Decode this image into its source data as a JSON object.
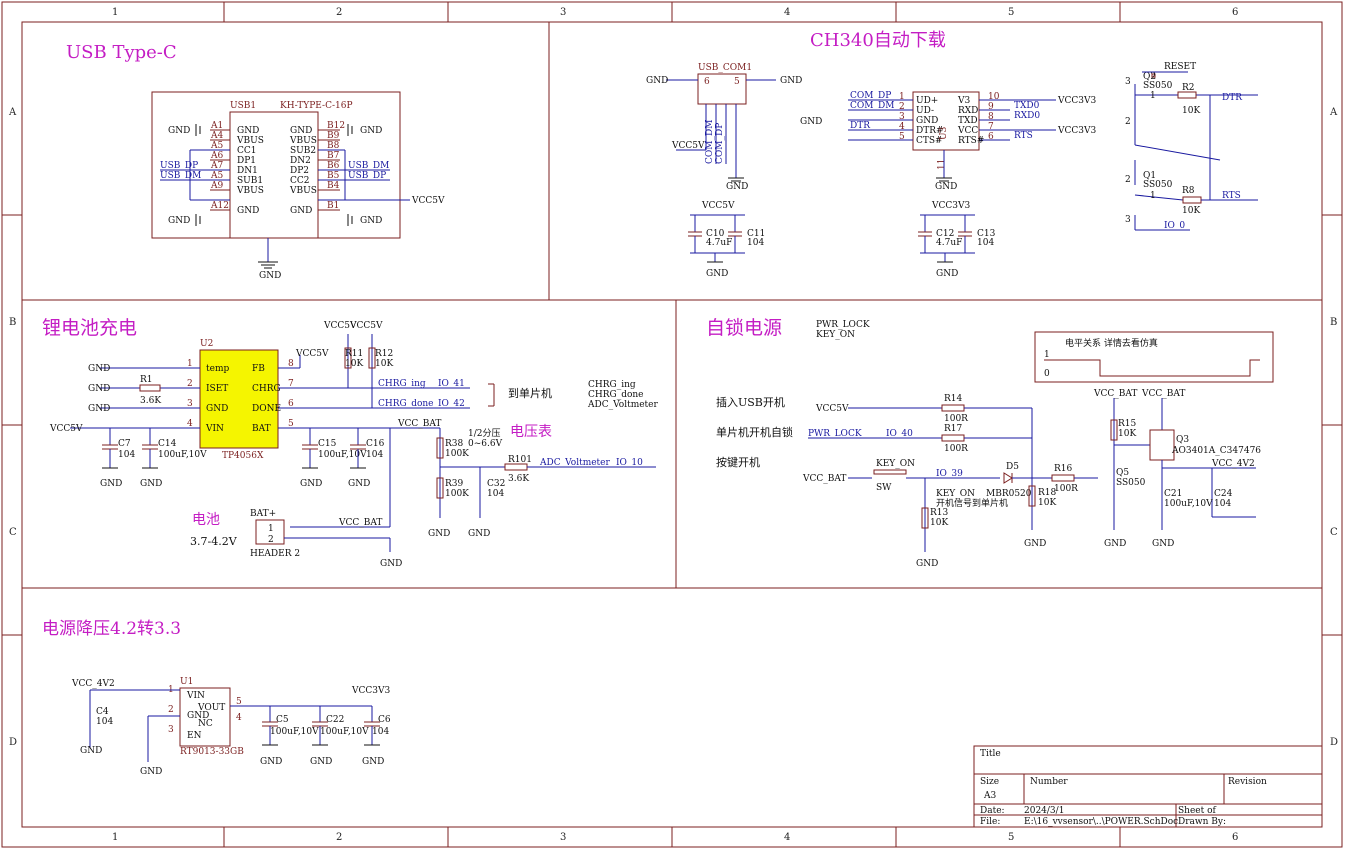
{
  "columns": [
    "1",
    "2",
    "3",
    "4",
    "5",
    "6"
  ],
  "rows": [
    "A",
    "B",
    "C",
    "D"
  ],
  "sections": {
    "usb": "USB Type-C",
    "ch340": "CH340自动下载",
    "battery": "锂电池充电",
    "selflock": "自锁电源",
    "ldo": "电源降压4.2转3.3"
  },
  "usb": {
    "designator": "USB1",
    "part": "KH-TYPE-C-16P",
    "left_pins": [
      [
        "A1",
        "GND"
      ],
      [
        "A4",
        "VBUS"
      ],
      [
        "A5",
        "CC1"
      ],
      [
        "A6",
        "DP1"
      ],
      [
        "A7",
        "DN1"
      ],
      [
        "A5",
        "SUB1"
      ],
      [
        "A9",
        "VBUS"
      ],
      [
        "A12",
        "GND"
      ]
    ],
    "right_pins": [
      [
        "B12",
        "GND"
      ],
      [
        "B9",
        "VBUS"
      ],
      [
        "B8",
        "SUB2"
      ],
      [
        "B7",
        "DN2"
      ],
      [
        "B6",
        "DP2"
      ],
      [
        "B5",
        "CC2"
      ],
      [
        "B4",
        "VBUS"
      ],
      [
        "B1",
        "GND"
      ]
    ],
    "nets": {
      "gnd": "GND",
      "dp": "USB_DP",
      "dm": "USB_DM",
      "vcc5v": "VCC5V"
    }
  },
  "usbcom": {
    "label": "USB_COM1",
    "pins": [
      "6",
      "5",
      "1",
      "2",
      "3",
      "4"
    ],
    "nets": [
      "COM_DM",
      "COM_DP",
      "VCC5V",
      "GND"
    ]
  },
  "ch340": {
    "left_pins": [
      [
        "1",
        "UD+"
      ],
      [
        "2",
        "UD-"
      ],
      [
        "3",
        "GND"
      ],
      [
        "4",
        "DTR#"
      ],
      [
        "5",
        "CTS#"
      ]
    ],
    "right_pins": [
      [
        "10",
        "V3"
      ],
      [
        "9",
        "RXD"
      ],
      [
        "8",
        "TXD"
      ],
      [
        "7",
        "VCC"
      ],
      [
        "6",
        "RTS#"
      ]
    ],
    "pad": "11",
    "refs": [
      "U3"
    ],
    "left_nets": [
      "COM_DP",
      "COM_DM",
      "GND",
      "DTR"
    ],
    "right_nets": [
      "VCC3V3",
      "TXD0",
      "RXD0",
      "VCC3V3",
      "RTS"
    ]
  },
  "caps_top": [
    {
      "net": "VCC5V",
      "c1": "C10",
      "v1": "4.7uF",
      "c2": "C11",
      "v2": "104"
    },
    {
      "net": "VCC3V3",
      "c1": "C12",
      "v1": "4.7uF",
      "c2": "C13",
      "v2": "104"
    }
  ],
  "autodl": {
    "q2": "Q2",
    "q1": "Q1",
    "model": "SS050",
    "model2": "SS050",
    "r2": "R2",
    "r8": "R8",
    "rv": "10K",
    "nets": [
      "RESET",
      "DTR",
      "RTS",
      "IO_0"
    ],
    "pin_nums": [
      "3",
      "1",
      "2"
    ]
  },
  "charger": {
    "designator": "U2",
    "part": "TP4056X",
    "left_pins": [
      [
        "1",
        "temp"
      ],
      [
        "2",
        "ISET"
      ],
      [
        "3",
        "GND"
      ],
      [
        "4",
        "VIN"
      ]
    ],
    "right_pins": [
      [
        "8",
        "FB"
      ],
      [
        "7",
        "CHRG"
      ],
      [
        "6",
        "DONE"
      ],
      [
        "5",
        "BAT"
      ]
    ],
    "nets": [
      "VCC5V",
      "VCC5V",
      "VCC5V",
      "VCC_BAT",
      "CHRG_ing",
      "CHRG_done",
      "IO_41",
      "IO_42",
      "GND"
    ],
    "r1": "R1",
    "r1v": "3.6K",
    "r11": "R11",
    "r12": "R12",
    "r10k": "10K",
    "caps": [
      [
        "C7",
        "104"
      ],
      [
        "C14",
        "100uF,10V"
      ],
      [
        "C15",
        "100uF,10V"
      ],
      [
        "C16",
        "104"
      ]
    ],
    "mcu_note": "到单片机",
    "side_labels": [
      "CHRG_ing",
      "CHRG_done",
      "ADC_Voltmeter"
    ],
    "voltmeter": "电压表",
    "divider_note": "1/2分压",
    "divider_range": "0~6.6V",
    "r38": "R38",
    "r39": "R39",
    "r100k": "100K",
    "c32": "C32",
    "c32v": "104",
    "r101": "R101",
    "r101v": "3.6K",
    "adc_net": "ADC_Voltmeter",
    "adc_io": "IO_10",
    "battery_title": "电池",
    "battery_range": "3.7-4.2V",
    "header": "BAT+",
    "header_part": "HEADER 2",
    "hp": [
      "1",
      "2"
    ],
    "vbat": "VCC_BAT"
  },
  "selflock": {
    "pwr_lock": "PWR_LOCK",
    "key_on": "KEY_ON",
    "level_title": "电平关系  详情去看仿真",
    "level_hi": "1",
    "level_lo": "0",
    "line1": "插入USB开机",
    "line2": "单片机开机自锁",
    "line3": "按键开机",
    "vcc5v": "VCC5V",
    "pwrlock": "PWR_LOCK",
    "io40": "IO_40",
    "vccbat": "VCC_BAT",
    "r14": "R14",
    "r17": "R17",
    "r100r": "100R",
    "sw": "SW",
    "keyon": "KEY_ON",
    "io39": "IO_39",
    "keyon2": "KEY_ON",
    "mbr": "MBR0520",
    "d5": "D5",
    "note": "开机信号到单片机",
    "r13": "R13",
    "r10k": "10K",
    "r18": "R18",
    "r16": "R16",
    "r15": "R15",
    "q5": "Q5",
    "q5m": "SS050",
    "q3": "Q3",
    "mos": "AO3401A_C347476",
    "vcc4v2": "VCC_4V2",
    "c21": "C21",
    "c21v": "100uF,10V",
    "c24": "C24",
    "c24v": "104",
    "vbat1": "VCC_BAT",
    "vbat2": "VCC_BAT"
  },
  "ldo": {
    "designator": "U1",
    "part": "RT9013-33GB",
    "left_pins": [
      [
        "1",
        "VIN"
      ],
      [
        "2",
        "GND"
      ],
      [
        "3",
        "EN"
      ]
    ],
    "right_pins": [
      [
        "5",
        "VOUT"
      ],
      [
        "4",
        "NC"
      ]
    ],
    "vin": "VCC_4V2",
    "vout": "VCC3V3",
    "c4": "C4",
    "c4v": "104",
    "caps": [
      [
        "C5",
        "100uF,10V"
      ],
      [
        "C22",
        "100uF,10V"
      ],
      [
        "C6",
        "104"
      ]
    ]
  },
  "gnd_label": "GND",
  "title_block": {
    "title": "Title",
    "size": "Size",
    "size_v": "A3",
    "number": "Number",
    "revision": "Revision",
    "date": "Date:",
    "date_v": "2024/3/1",
    "file": "File:",
    "file_v": "E:\\16_vvsensor\\..\\POWER.SchDoc",
    "sheet": "Sheet   of",
    "drawn": "Drawn By:"
  }
}
